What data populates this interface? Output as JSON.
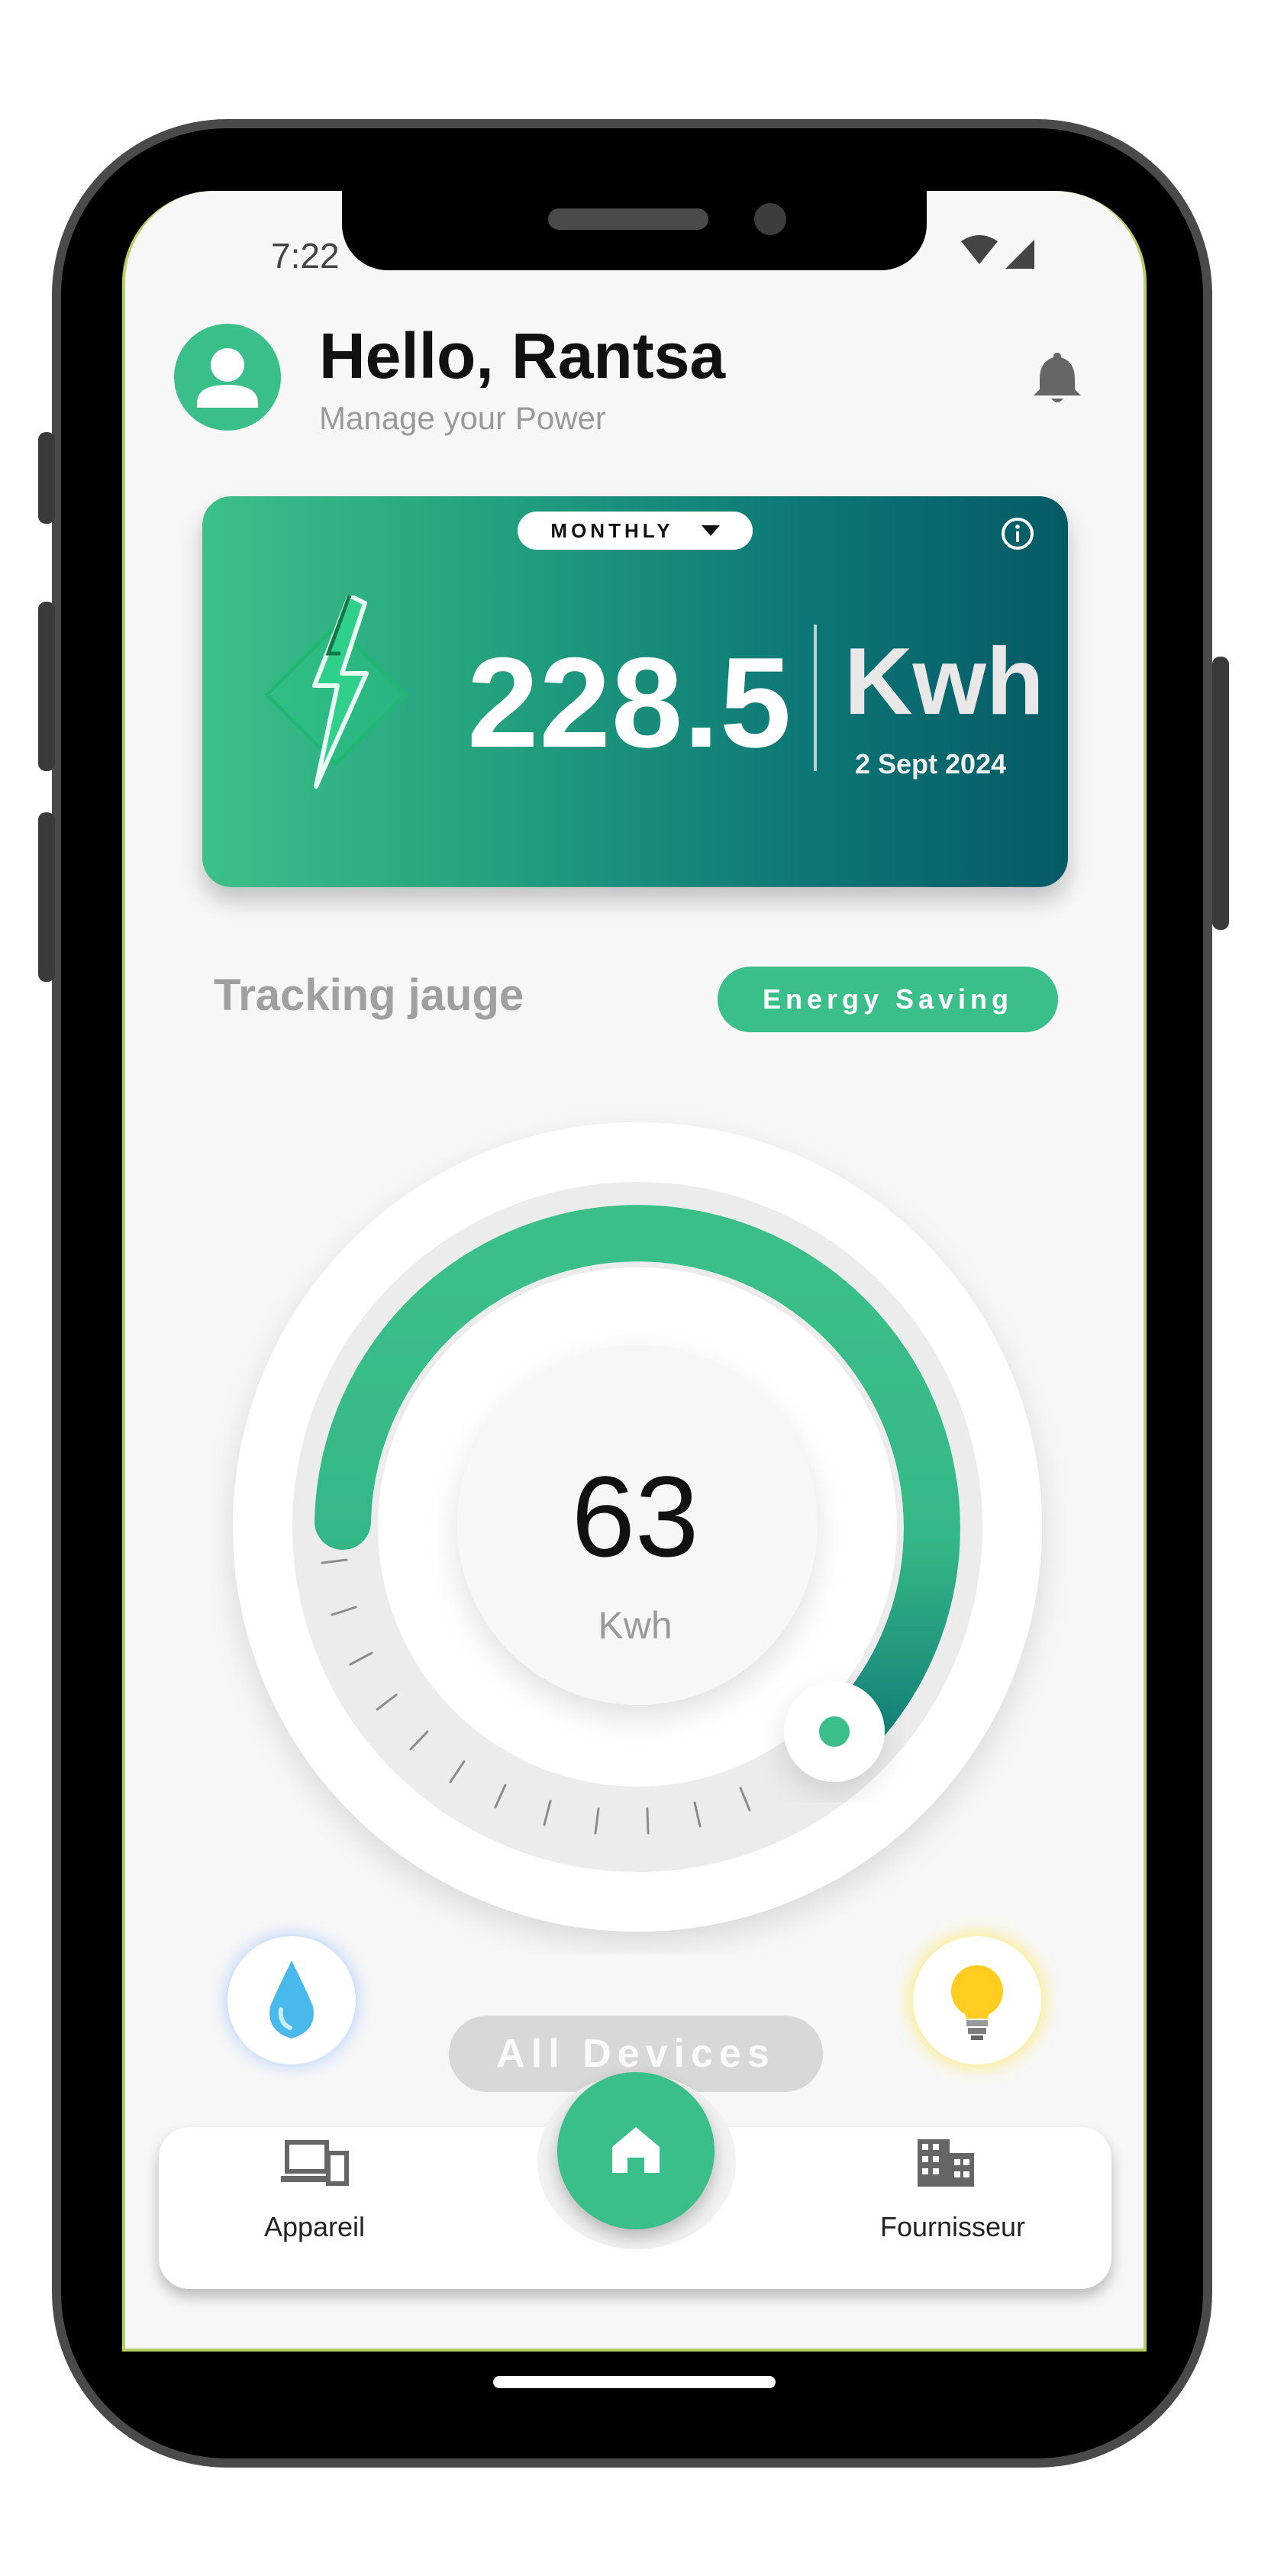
{
  "status": {
    "time": "7:22"
  },
  "header": {
    "greeting": "Hello, Rantsa",
    "subtitle": "Manage your Power"
  },
  "energy_card": {
    "period": "MONTHLY",
    "value": "228.5",
    "unit": "Kwh",
    "date": "2 Sept 2024"
  },
  "tracking": {
    "label": "Tracking jauge",
    "button": "Energy Saving"
  },
  "gauge": {
    "value": "63",
    "unit": "Kwh"
  },
  "devices": {
    "label": "All Devices"
  },
  "nav": {
    "left": "Appareil",
    "right": "Fournisseur"
  },
  "colors": {
    "accent": "#3bbf8a",
    "card_start": "#3cc089",
    "card_end": "#055a66"
  },
  "icons": [
    "profile-icon",
    "bell-icon",
    "info-icon",
    "lightning-icon",
    "water-drop-icon",
    "lightbulb-icon",
    "home-icon",
    "devices-icon",
    "building-icon"
  ]
}
